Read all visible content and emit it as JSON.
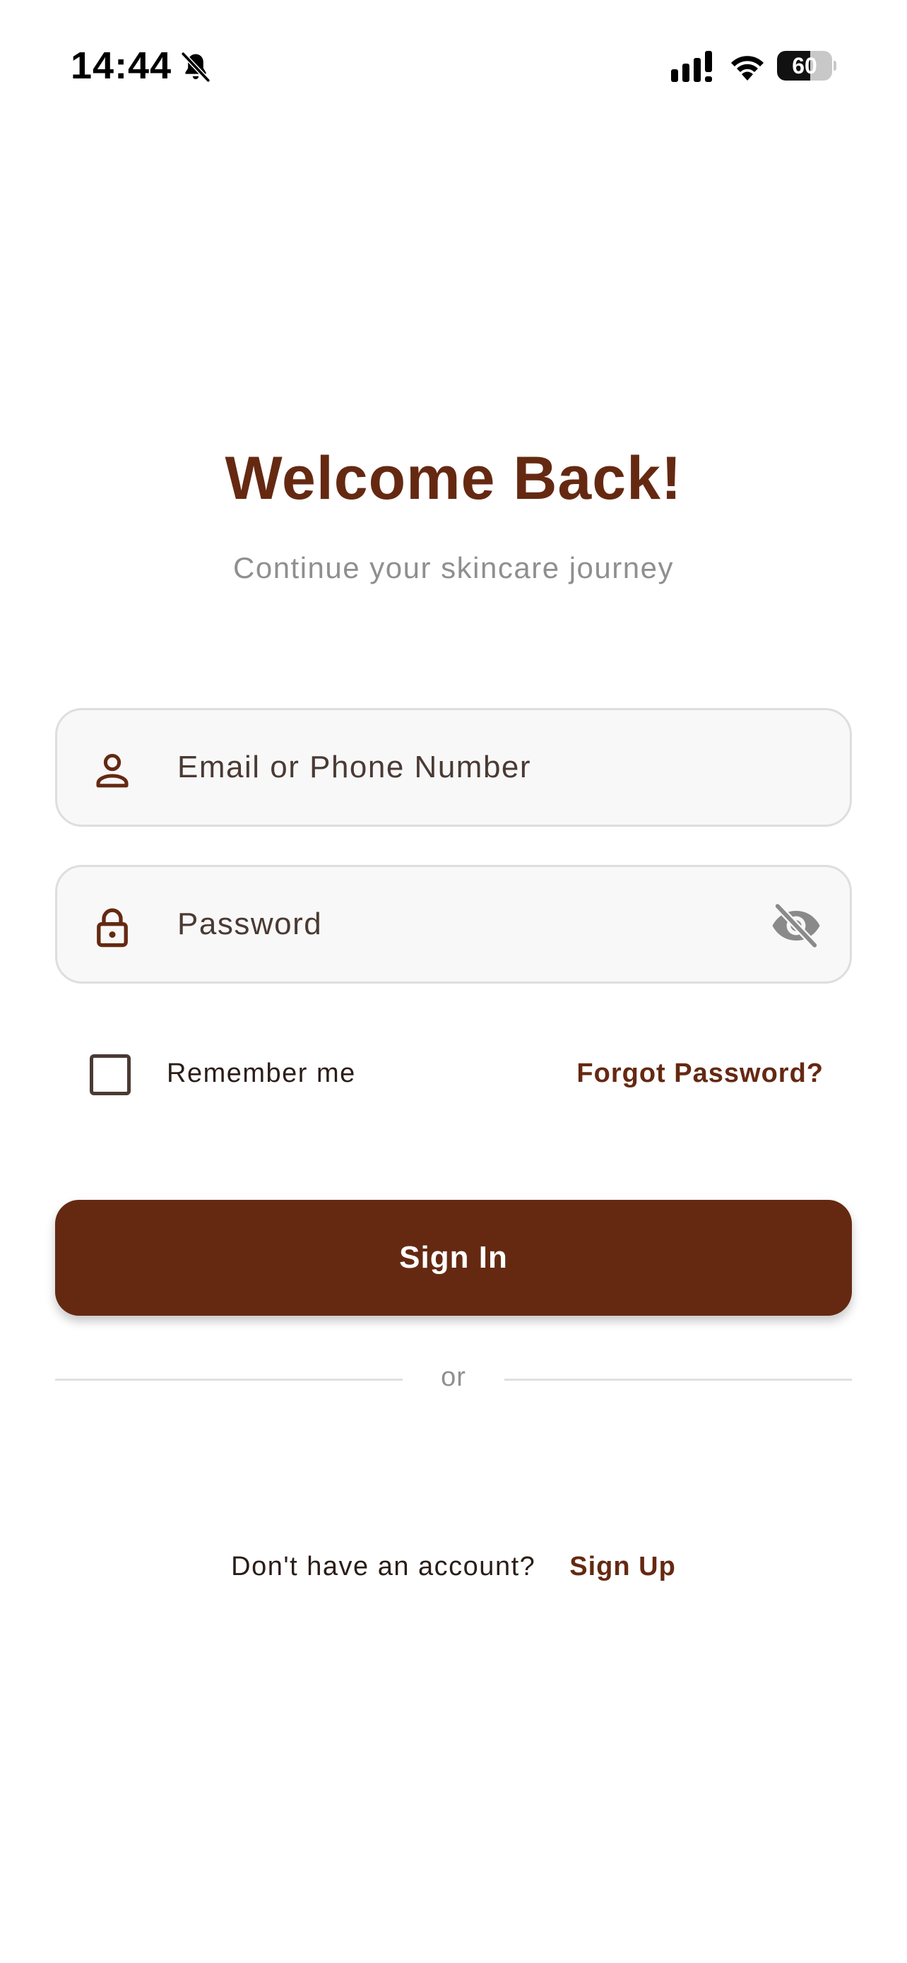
{
  "status_bar": {
    "time": "14:44",
    "battery_level": "60",
    "battery_fraction": 0.6,
    "icons": [
      "bell-muted-icon",
      "cellular-signal-icon",
      "wifi-icon",
      "battery-icon"
    ]
  },
  "header": {
    "title": "Welcome Back!",
    "subtitle": "Continue your skincare journey"
  },
  "form": {
    "email": {
      "placeholder": "Email or Phone Number",
      "value": "",
      "icon": "person-icon"
    },
    "password": {
      "placeholder": "Password",
      "value": "",
      "icon": "lock-icon",
      "toggle_icon": "eye-off-icon"
    },
    "remember_me": {
      "label": "Remember me",
      "checked": false
    },
    "forgot_password_label": "Forgot Password?",
    "sign_in_label": "Sign In",
    "divider_text": "or"
  },
  "footer": {
    "prompt": "Don't have an account?",
    "sign_up_label": "Sign Up"
  },
  "colors": {
    "brand": "#652912",
    "text_muted": "#8f8f8f",
    "field_background": "#f8f8f8",
    "field_border": "#dedede"
  }
}
